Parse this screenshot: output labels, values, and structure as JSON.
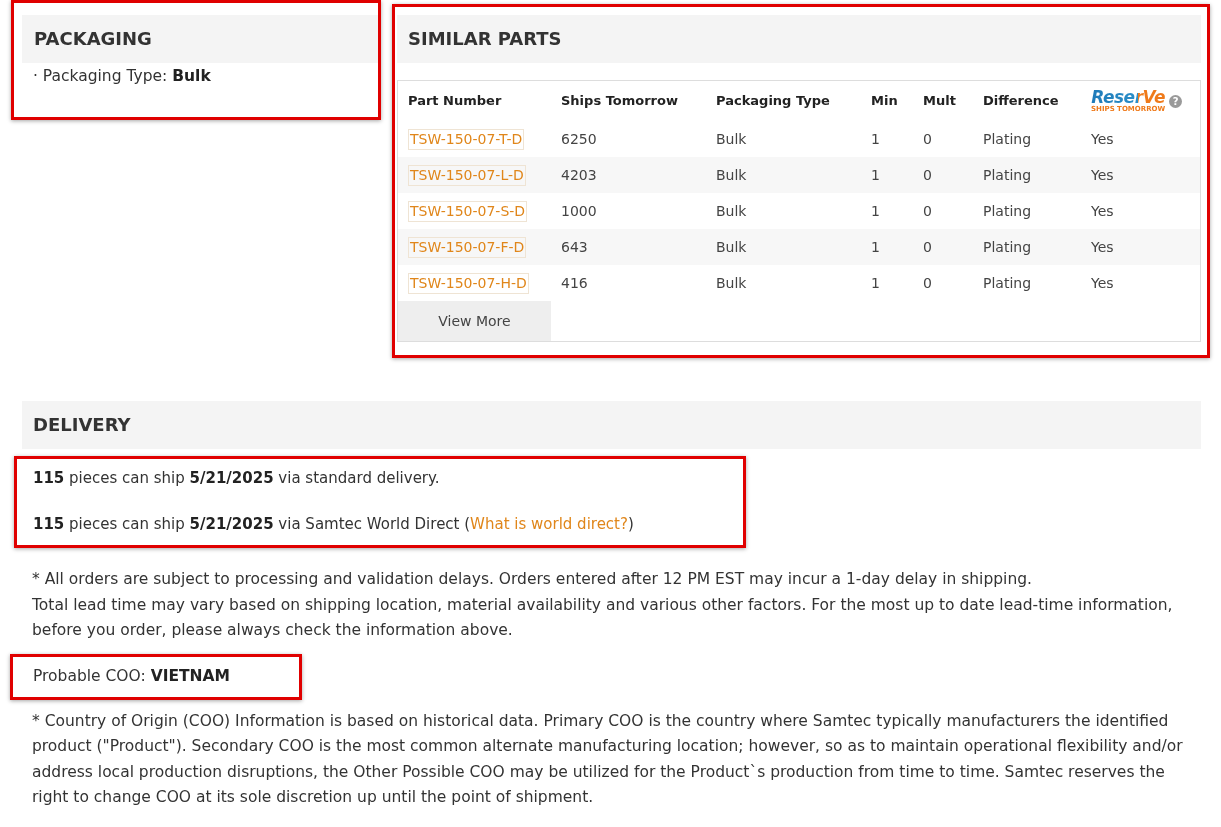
{
  "packaging": {
    "highlighted": true,
    "title": "PACKAGING",
    "items": [
      "· Packaging Type: **Bulk**"
    ]
  },
  "similar_parts": {
    "highlighted": true,
    "title": "SIMILAR PARTS",
    "table": {
      "columns": [
        {
          "kind": "link",
          "label": "Part Number"
        },
        {
          "kind": "text",
          "label": "Ships Tomorrow"
        },
        {
          "kind": "text",
          "label": "Packaging Type"
        },
        {
          "kind": "text",
          "label": "Min"
        },
        {
          "kind": "text",
          "label": "Mult"
        },
        {
          "kind": "text",
          "label": "Difference"
        },
        {
          "kind": "text",
          "logo": "ReserVe",
          "tagline": "SHIPS TOMORROW",
          "help": "?"
        }
      ],
      "rows": [
        [
          "TSW-150-07-T-D",
          "6250",
          "Bulk",
          "1",
          "0",
          "Plating",
          "Yes"
        ],
        [
          "TSW-150-07-L-D",
          "4203",
          "Bulk",
          "1",
          "0",
          "Plating",
          "Yes"
        ],
        [
          "TSW-150-07-S-D",
          "1000",
          "Bulk",
          "1",
          "0",
          "Plating",
          "Yes"
        ],
        [
          "TSW-150-07-F-D",
          "643",
          "Bulk",
          "1",
          "0",
          "Plating",
          "Yes"
        ],
        [
          "TSW-150-07-H-D",
          "416",
          "Bulk",
          "1",
          "0",
          "Plating",
          "Yes"
        ]
      ],
      "view_more": "View More"
    }
  },
  "delivery": {
    "title": "DELIVERY",
    "availability": {
      "highlighted": true,
      "lines": [
        {
          "text": "**115** pieces can ship **5/21/2025** via standard delivery."
        },
        {
          "text": "**115** pieces can ship **5/21/2025** via Samtec World Direct (",
          "link": "What is world direct?",
          "after": ")"
        }
      ]
    },
    "notes": [
      "* All orders are subject to processing and validation delays. Orders entered after 12 PM EST may incur a 1-day delay in shipping.",
      "Total lead time may vary based on shipping location, material availability and various other factors. For the most up to date lead-time information, before you order, please always check the information above."
    ],
    "coo": {
      "highlighted": true,
      "text": "Probable COO: **VIETNAM**"
    },
    "coo_note": "* Country of Origin (COO) Information is based on historical data. Primary COO is the country where Samtec typically manufacturers the identified product (\"Product\"). Secondary COO is the most common alternate manufacturing location; however, so as to maintain operational flexibility and/or address local production disruptions, the Other Possible COO may be utilized for the Product`s production from time to time. Samtec reserves the right to change COO at its sole discretion up until the point of shipment."
  }
}
